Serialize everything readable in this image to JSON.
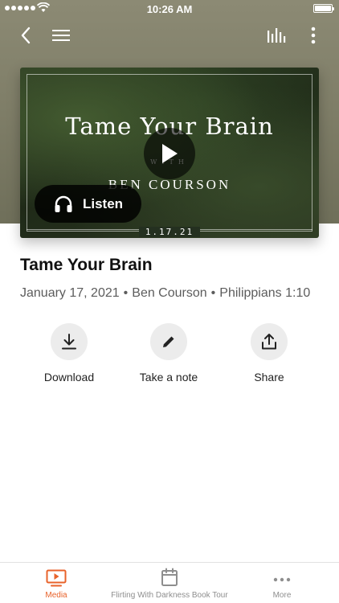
{
  "status_bar": {
    "time": "10:26 AM"
  },
  "hero": {
    "title": "Tame Your Brain",
    "with": "WITH",
    "speaker": "BEN COURSON",
    "date": "1.17.21",
    "listen_label": "Listen"
  },
  "sermon": {
    "title": "Tame Your Brain",
    "date": "January 17, 2021",
    "separator": "•",
    "speaker": "Ben Courson",
    "scripture": "Philippians 1:10"
  },
  "actions": {
    "download": "Download",
    "note": "Take a note",
    "share": "Share"
  },
  "tabbar": {
    "media": "Media",
    "flirting": "Flirting With Darkness Book Tour",
    "more": "More"
  },
  "colors": {
    "accent": "#e8622a",
    "inactive": "#8e8e8e",
    "header_band": "#7d7c66"
  }
}
